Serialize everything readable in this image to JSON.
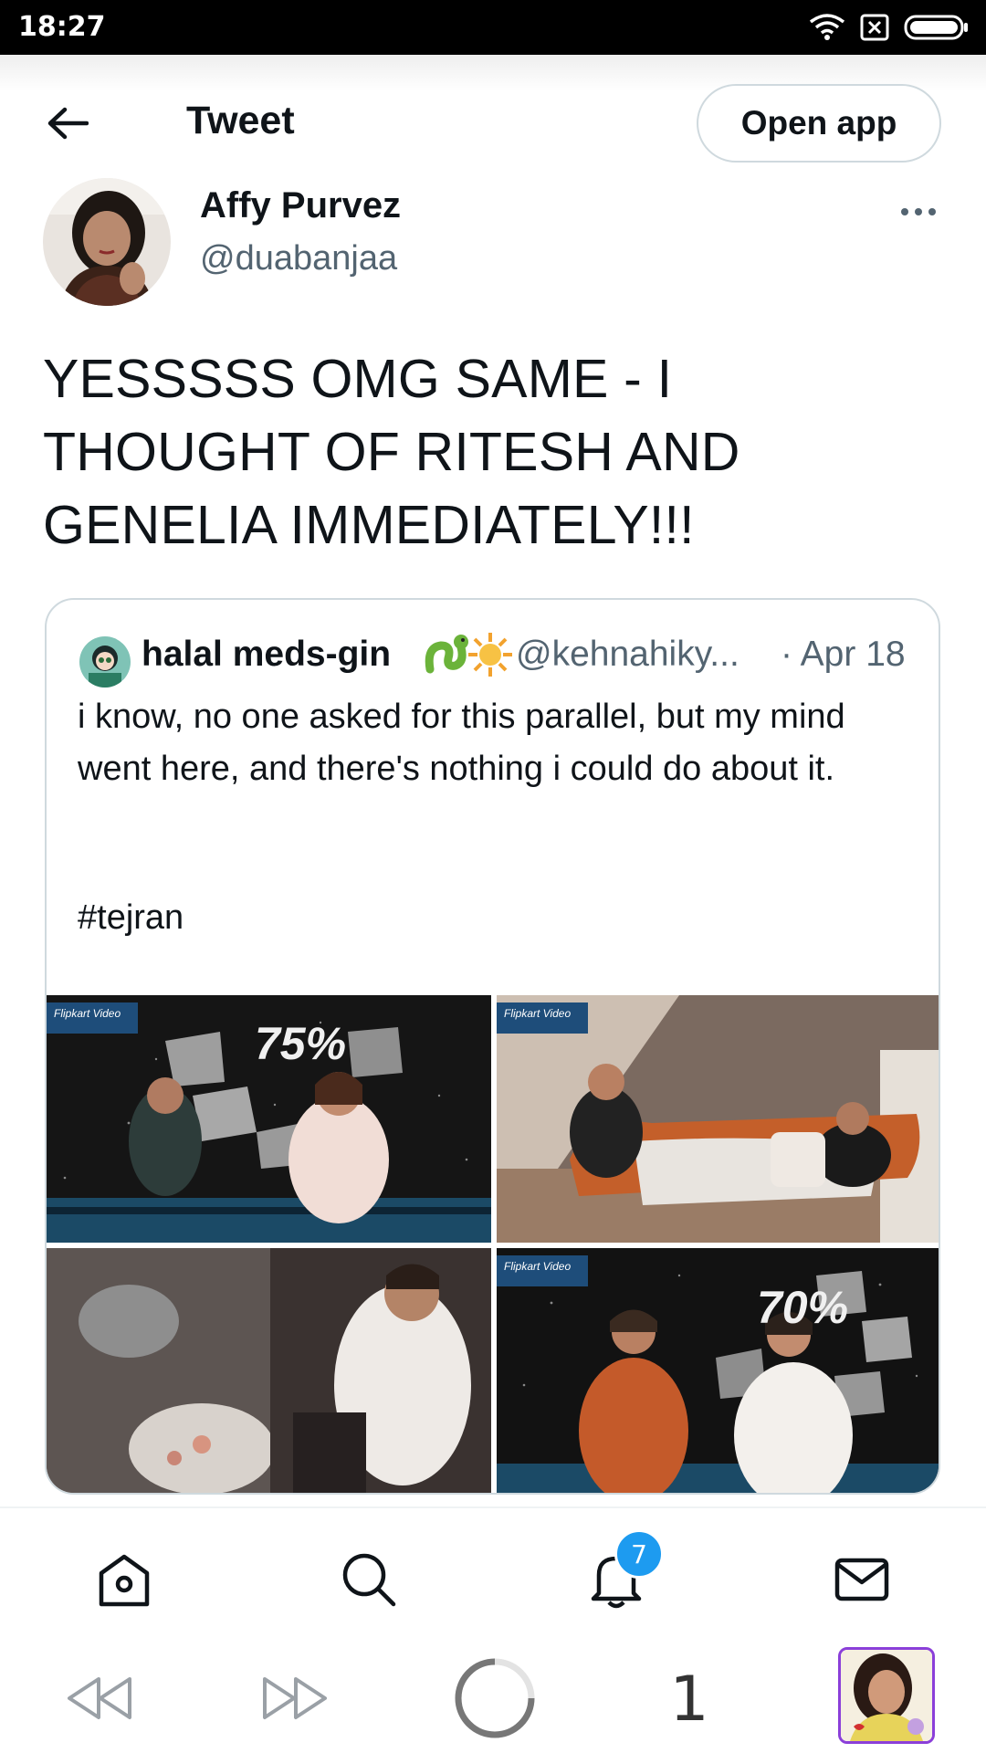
{
  "status_bar": {
    "time": "18:27"
  },
  "header": {
    "title": "Tweet",
    "open_app_label": "Open app"
  },
  "tweet": {
    "author_name": "Affy Purvez",
    "author_handle": "@duabanjaa",
    "text": "YESSSSS OMG SAME - I THOUGHT OF RITESH AND GENELIA IMMEDIATELY!!!"
  },
  "quoted_tweet": {
    "author_name": "halal meds-gin",
    "author_handle": "@kehnahiky...",
    "date": "· Apr 18",
    "text": "i know, no one asked for this parallel, but my mind went here, and there's nothing i could do about it.",
    "hashtag": "#tejran",
    "media": [
      {
        "overlay": "75%",
        "watermark": "Flipkart Video"
      },
      {
        "overlay": "",
        "watermark": "Flipkart Video"
      },
      {
        "overlay": "",
        "watermark": ""
      },
      {
        "overlay": "70%",
        "watermark": "Flipkart Video"
      }
    ]
  },
  "bottom_nav": {
    "items": [
      "home-icon",
      "search-icon",
      "notifications-icon",
      "messages-icon"
    ],
    "notification_count": "7"
  },
  "browser_bar": {
    "tab_count": "1"
  },
  "colors": {
    "accent": "#1d9bf0",
    "text": "#0f1419",
    "muted": "#536471",
    "border": "#cfd9de"
  }
}
